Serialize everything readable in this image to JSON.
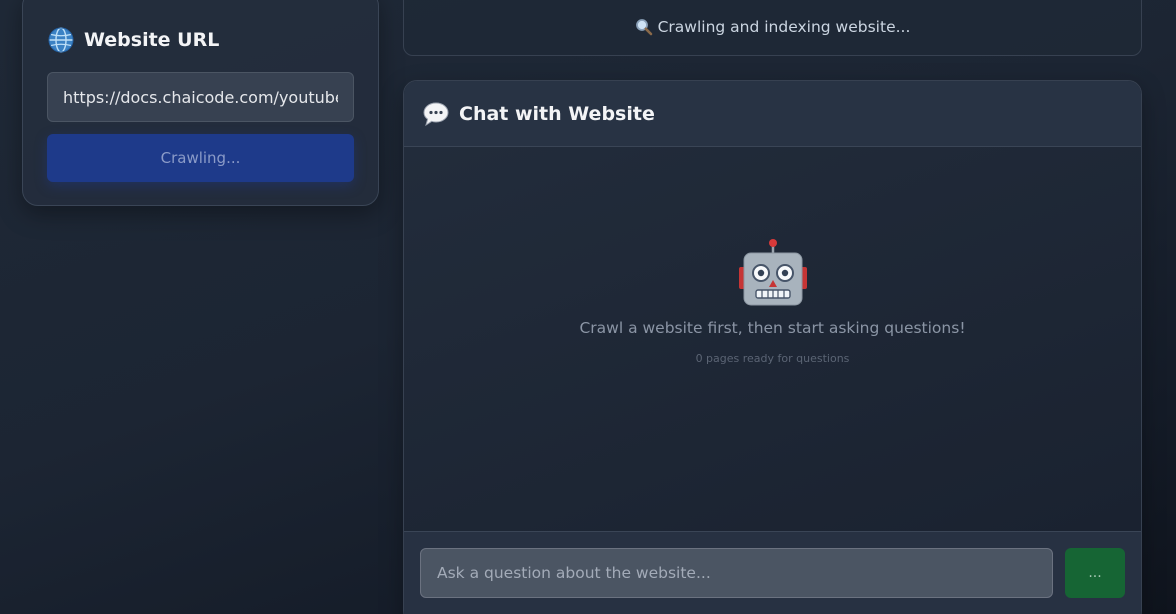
{
  "sidebar": {
    "title": "Website URL",
    "title_icon": "globe-icon",
    "url_value": "https://docs.chaicode.com/youtube/getting-started/",
    "crawl_button_label": "Crawling..."
  },
  "status": {
    "icon": "magnifier-icon",
    "text": "Crawling and indexing website..."
  },
  "chat": {
    "title": "Chat with Website",
    "title_icon": "speech-bubble-icon",
    "empty_icon": "robot-icon",
    "empty_message": "Crawl a website first, then start asking questions!",
    "pages_ready": "0 pages ready for questions",
    "input_placeholder": "Ask a question about the website...",
    "send_button_label": "..."
  },
  "colors": {
    "primary_button": "#1e3a8a",
    "send_button": "#166534",
    "background": "#1c2533"
  }
}
